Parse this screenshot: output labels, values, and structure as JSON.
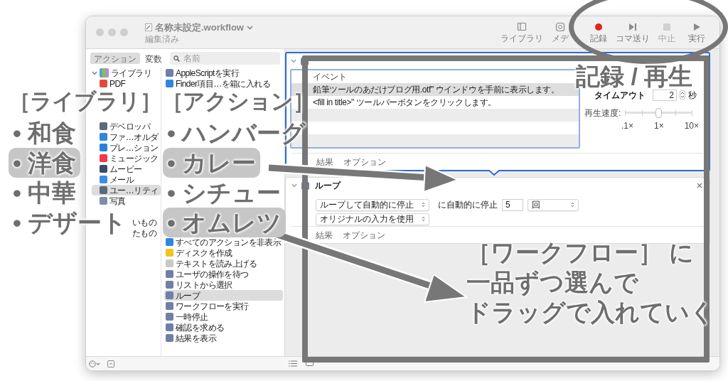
{
  "window": {
    "title": "名称未設定.workflow",
    "subtitle": "編集済み"
  },
  "toolbar": [
    {
      "kind": "library",
      "label": "ライブラリ",
      "disabled": false
    },
    {
      "kind": "media",
      "label": "メデ",
      "disabled": false
    },
    {
      "kind": "record",
      "label": "記録",
      "disabled": false
    },
    {
      "kind": "step",
      "label": "コマ送り",
      "disabled": false
    },
    {
      "kind": "stop",
      "label": "中止",
      "disabled": true
    },
    {
      "kind": "run",
      "label": "実行",
      "disabled": false
    }
  ],
  "sidebar": {
    "tabs": [
      {
        "label": "アクション",
        "selected": true
      },
      {
        "label": "変数",
        "selected": false
      }
    ],
    "search": {
      "placeholder": "名前"
    },
    "library": {
      "label": "ライブラリ",
      "expanded": true,
      "children": [
        {
          "label": "PDF",
          "kind": "pdf",
          "selected": false
        },
        {
          "label": "デベロッパ",
          "kind": "tools",
          "selected": false
        },
        {
          "label": "ファ…オルダ",
          "kind": "finder",
          "selected": false
        },
        {
          "label": "プレ…ション",
          "kind": "presentation",
          "selected": false
        },
        {
          "label": "ミュージック",
          "kind": "music",
          "selected": false
        },
        {
          "label": "ムービー",
          "kind": "movie",
          "selected": false
        },
        {
          "label": "メール",
          "kind": "mail",
          "selected": false
        },
        {
          "label": "ユー…リティ",
          "kind": "tools",
          "selected": true
        },
        {
          "label": "写真",
          "kind": "photos",
          "selected": false
        },
        {
          "label": "いもの",
          "kind": "partial",
          "selected": false
        },
        {
          "label": "たもの",
          "kind": "partial",
          "selected": false
        }
      ]
    },
    "actions": [
      {
        "label": "AppleScriptを実行",
        "kind": "script",
        "selected": false
      },
      {
        "label": "Finder項目…を箱に入れる",
        "kind": "finder",
        "selected": false
      },
      {
        "label": "すべてのアクションを非表示",
        "kind": "finder",
        "selected": false
      },
      {
        "label": "ディスクを作成",
        "kind": "disk",
        "selected": false
      },
      {
        "label": "テキストを読み上げる",
        "kind": "speech",
        "selected": false
      },
      {
        "label": "ユーザの操作を待つ",
        "kind": "script",
        "selected": false
      },
      {
        "label": "リストから選択",
        "kind": "script",
        "selected": false
      },
      {
        "label": "ループ",
        "kind": "script",
        "selected": true
      },
      {
        "label": "ワークフローを実行",
        "kind": "script",
        "selected": false
      },
      {
        "label": "一時停止",
        "kind": "script",
        "selected": false
      },
      {
        "label": "確認を求める",
        "kind": "script",
        "selected": false
      },
      {
        "label": "結果を表示",
        "kind": "script",
        "selected": false
      }
    ]
  },
  "workflow": {
    "record_action": {
      "events": {
        "column": "イベント",
        "rows": [
          {
            "text": "鉛筆ツールのあだけブログ用.otf\" ウインドウを手前に表示します。",
            "selected": true
          },
          {
            "text": "<fill in title>\" ツールバーボタンをクリックします。",
            "selected": false
          }
        ]
      },
      "timeout": {
        "label": "タイムアウト",
        "value": "2",
        "unit": "秒"
      },
      "speed": {
        "label": "再生速度:",
        "level": 0.5,
        "ticks": [
          ".1×",
          "1×",
          "10×"
        ]
      },
      "footer_tabs": [
        "結果",
        "オプション"
      ]
    },
    "loop_action": {
      "title": "ループ",
      "mode": "ループして自動的に停止",
      "stop_label": "に自動的に停止",
      "count": "5",
      "unit": "回",
      "input": "オリジナルの入力を使用",
      "footer_tabs": [
        "結果",
        "オプション"
      ]
    }
  },
  "annotations": {
    "heading": "［ライブラリ］［アクション］",
    "cuisines": [
      {
        "label": "• 和食",
        "highlighted": false
      },
      {
        "label": "• 洋食",
        "highlighted": true
      },
      {
        "label": "• 中華",
        "highlighted": false
      },
      {
        "label": "• デザート",
        "highlighted": false
      }
    ],
    "dishes": [
      {
        "label": "• ハンバーグ",
        "highlighted": false
      },
      {
        "label": "• カレー",
        "highlighted": true
      },
      {
        "label": "• シチュー",
        "highlighted": false
      },
      {
        "label": "• オムレツ",
        "highlighted": true
      }
    ],
    "record_note": "記録 / 再生",
    "workflow_note": [
      "［ワークフロー］ に",
      "一品ずつ選んで",
      "ドラッグで入れていく"
    ]
  }
}
